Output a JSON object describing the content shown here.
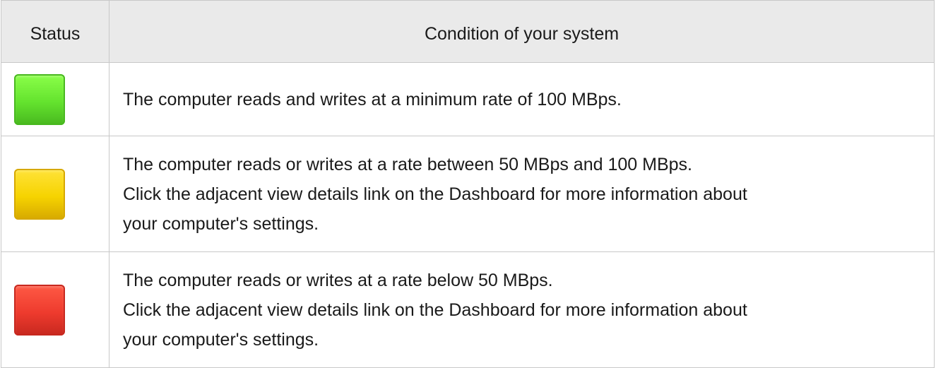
{
  "table": {
    "headers": [
      "Status",
      "Condition of your system"
    ],
    "rows": [
      {
        "status": "green",
        "status_color": "#64e32e",
        "status_color_light": "#8cff4a",
        "status_color_dark": "#48b81f",
        "lines": [
          "The computer reads and writes at a minimum rate of 100 MBps."
        ]
      },
      {
        "status": "yellow",
        "status_color": "#f6d300",
        "status_color_light": "#ffe33a",
        "status_color_dark": "#d6a800",
        "lines": [
          "The computer reads or writes at a rate between 50 MBps and 100 MBps.",
          "Click the adjacent view details link on the Dashboard for more information about",
          "your computer's settings."
        ]
      },
      {
        "status": "red",
        "status_color": "#ee3b2e",
        "status_color_light": "#ff5a45",
        "status_color_dark": "#c7281f",
        "lines": [
          "The computer reads or writes at a rate below 50 MBps.",
          "Click the adjacent view details link on the Dashboard for more information about",
          "your computer's settings."
        ]
      }
    ]
  }
}
